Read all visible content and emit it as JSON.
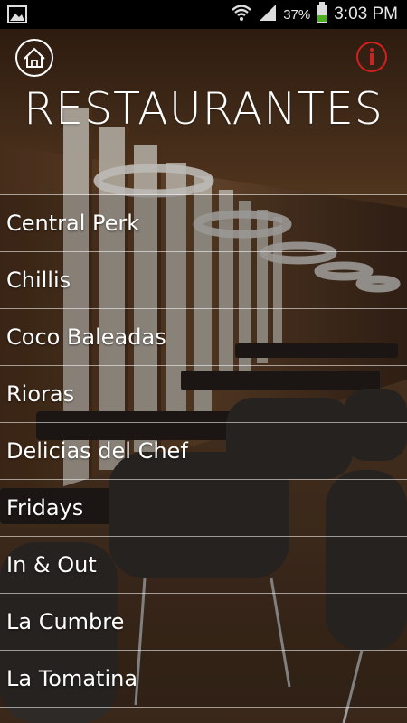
{
  "status_bar": {
    "battery_percent": "37%",
    "time": "3:03 PM",
    "icons": [
      "image-notification-icon",
      "wifi-icon",
      "signal-icon",
      "battery-icon"
    ]
  },
  "header": {
    "title": "RESTAURANTES",
    "home_icon": "home-icon",
    "info_icon": "info-icon",
    "info_color": "#d32020"
  },
  "restaurants": [
    {
      "label": "Central Perk"
    },
    {
      "label": "Chillis"
    },
    {
      "label": "Coco Baleadas"
    },
    {
      "label": "Rioras"
    },
    {
      "label": "Delicias del Chef"
    },
    {
      "label": "Fridays"
    },
    {
      "label": "In & Out"
    },
    {
      "label": "La Cumbre"
    },
    {
      "label": "La Tomatina"
    }
  ]
}
